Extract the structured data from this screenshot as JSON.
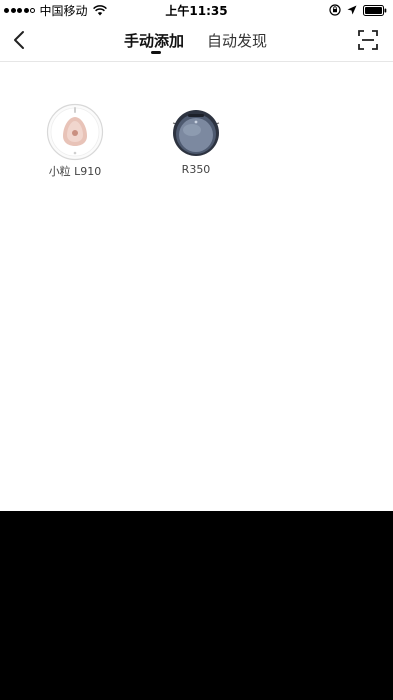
{
  "status_bar": {
    "carrier": "中国移动",
    "time": "上午11:35"
  },
  "nav": {
    "tabs": [
      {
        "label": "手动添加",
        "active": true
      },
      {
        "label": "自动发现",
        "active": false
      }
    ],
    "icons": {
      "back": "chevron-left-icon",
      "scan": "scan-icon"
    }
  },
  "devices": [
    {
      "label": "小粒 L910",
      "icon": "robot-vacuum-white-icon"
    },
    {
      "label": "R350",
      "icon": "robot-vacuum-dark-icon"
    }
  ],
  "colors": {
    "background": "#ffffff",
    "text_primary": "#111111",
    "text_secondary": "#444444",
    "divider": "#e6e6e6",
    "lower_area": "#000000"
  }
}
